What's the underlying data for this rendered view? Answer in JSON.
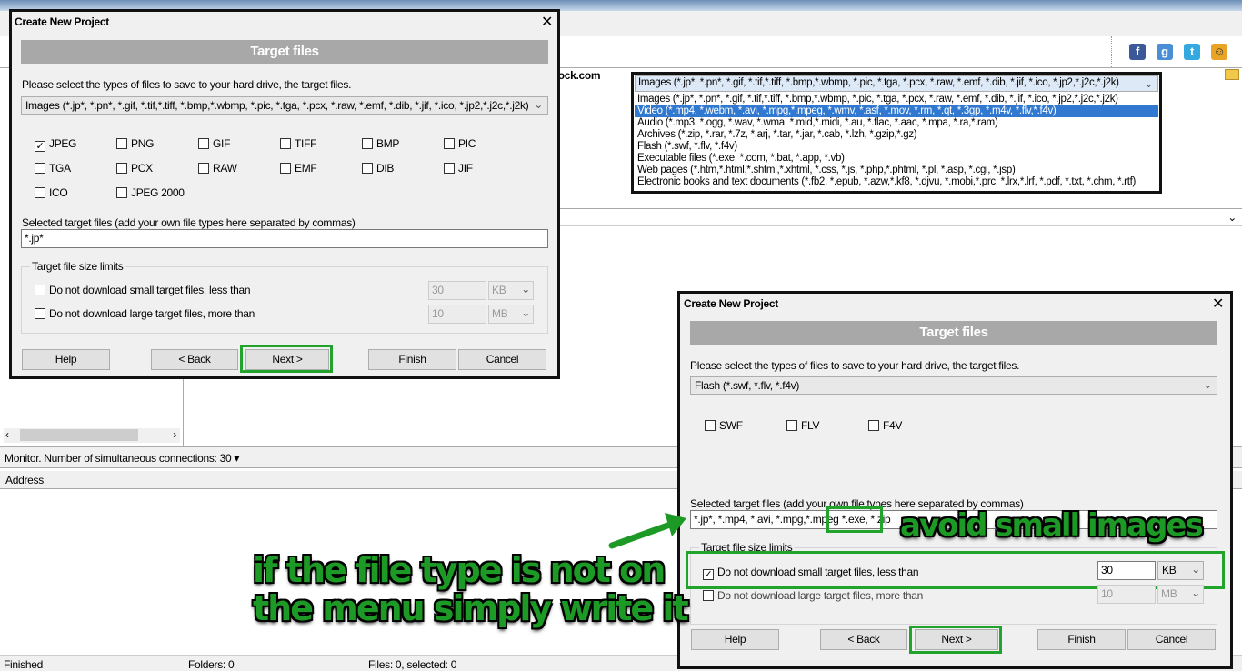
{
  "app": {
    "site_fragment": "tock.com",
    "monitor": "Monitor. Number of simultaneous connections: 30",
    "address_col": "Address",
    "status": {
      "left": "Finished",
      "folders": "Folders: 0",
      "files": "Files: 0, selected: 0"
    }
  },
  "dialog1": {
    "title": "Create New Project",
    "header": "Target files",
    "prompt": "Please select the types of files to save to your hard drive, the target files.",
    "type_select": "Images (*.jp*, *.pn*, *.gif, *.tif,*.tiff, *.bmp,*.wbmp, *.pic, *.tga, *.pcx, *.raw, *.emf, *.dib, *.jif, *.ico, *.jp2,*.j2c,*.j2k)",
    "checkboxes": [
      {
        "label": "JPEG",
        "checked": true
      },
      {
        "label": "PNG",
        "checked": false
      },
      {
        "label": "GIF",
        "checked": false
      },
      {
        "label": "TIFF",
        "checked": false
      },
      {
        "label": "BMP",
        "checked": false
      },
      {
        "label": "PIC",
        "checked": false
      },
      {
        "label": "TGA",
        "checked": false
      },
      {
        "label": "PCX",
        "checked": false
      },
      {
        "label": "RAW",
        "checked": false
      },
      {
        "label": "EMF",
        "checked": false
      },
      {
        "label": "DIB",
        "checked": false
      },
      {
        "label": "JIF",
        "checked": false
      },
      {
        "label": "ICO",
        "checked": false
      },
      {
        "label": "JPEG 2000",
        "checked": false
      }
    ],
    "selected_label": "Selected target files (add your own file types here separated by commas)",
    "selected_value": "*.jp*",
    "limits_label": "Target file size limits",
    "small": {
      "label": "Do not download small target files, less than",
      "checked": false,
      "value": "30",
      "unit": "KB"
    },
    "large": {
      "label": "Do not download large target files, more than",
      "checked": false,
      "value": "10",
      "unit": "MB"
    },
    "buttons": {
      "help": "Help",
      "back": "< Back",
      "next": "Next >",
      "finish": "Finish",
      "cancel": "Cancel"
    }
  },
  "dropdown": {
    "current": "Images (*.jp*, *.pn*, *.gif, *.tif,*.tiff, *.bmp,*.wbmp, *.pic, *.tga, *.pcx, *.raw, *.emf, *.dib, *.jif, *.ico, *.jp2,*.j2c,*.j2k)",
    "selected_index": 1,
    "highlight": "#3078d0",
    "items": [
      "Images (*.jp*, *.pn*, *.gif, *.tif,*.tiff, *.bmp,*.wbmp, *.pic, *.tga, *.pcx, *.raw, *.emf, *.dib, *.jif, *.ico, *.jp2,*.j2c,*.j2k)",
      "Video (*.mp4, *.webm, *.avi, *.mpg,*.mpeg, *.wmv, *.asf, *.mov, *.rm, *.qt, *.3gp, *.m4v, *.flv,*.f4v)",
      "Audio (*.mp3, *.ogg, *.wav, *.wma, *.mid,*.midi, *.au, *.flac, *.aac, *.mpa, *.ra,*.ram)",
      "Archives (*.zip, *.rar, *.7z, *.arj, *.tar, *.jar, *.cab, *.lzh, *.gzip,*.gz)",
      "Flash (*.swf, *.flv, *.f4v)",
      "Executable files (*.exe, *.com, *.bat, *.app, *.vb)",
      "Web pages (*.htm,*.html,*.shtml,*.xhtml, *.css, *.js, *.php,*.phtml, *.pl, *.asp, *.cgi, *.jsp)",
      "Electronic books and text documents (*.fb2, *.epub, *.azw,*.kf8, *.djvu, *.mobi,*.prc, *.lrx,*.lrf, *.pdf, *.txt, *.chm, *.rtf)"
    ]
  },
  "dialog2": {
    "title": "Create New Project",
    "header": "Target files",
    "prompt": "Please select the types of files to save to your hard drive, the target files.",
    "type_select": "Flash (*.swf, *.flv, *.f4v)",
    "checkboxes": [
      {
        "label": "SWF",
        "checked": false
      },
      {
        "label": "FLV",
        "checked": false
      },
      {
        "label": "F4V",
        "checked": false
      }
    ],
    "selected_label": "Selected target files (add your own file types here separated by commas)",
    "selected_value_a": "*.jp*, *.mp4, *.avi, *.mpg,*.mpeg",
    "selected_value_b": "*.exe, *.zip",
    "limits_label": "Target file size limits",
    "small": {
      "label": "Do not download small target files, less than",
      "checked": true,
      "value": "30",
      "unit": "KB"
    },
    "large": {
      "label": "Do not download large target files, more than",
      "checked": false,
      "value": "10",
      "unit": "MB"
    },
    "buttons": {
      "help": "Help",
      "back": "< Back",
      "next": "Next >",
      "finish": "Finish",
      "cancel": "Cancel"
    }
  },
  "annotations": {
    "avoid": "avoid small images",
    "hint_line1": "if the file type is not on",
    "hint_line2": "the menu simply write it",
    "color": "#1d9a25"
  }
}
